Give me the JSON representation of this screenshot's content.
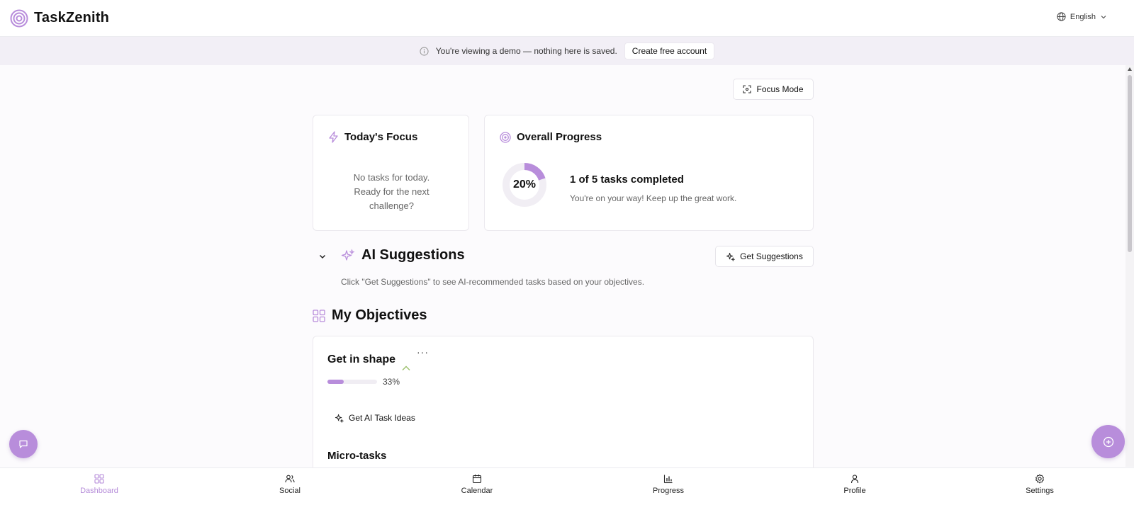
{
  "app": {
    "title": "TaskZenith"
  },
  "header": {
    "language": "English"
  },
  "banner": {
    "text": "You're viewing a demo — nothing here is saved.",
    "cta": "Create free account"
  },
  "toolbar": {
    "focus_mode": "Focus Mode"
  },
  "todays_focus": {
    "title": "Today's Focus",
    "empty_line1": "No tasks for today.",
    "empty_line2": "Ready for the next",
    "empty_line3": "challenge?"
  },
  "overall_progress": {
    "title": "Overall Progress",
    "percent_label": "20%",
    "percent_value": 20,
    "summary": "1 of 5 tasks completed",
    "message": "You're on your way! Keep up the great work."
  },
  "ai_suggestions": {
    "title": "AI Suggestions",
    "button": "Get Suggestions",
    "hint": "Click \"Get Suggestions\" to see AI-recommended tasks based on your objectives."
  },
  "objectives": {
    "title": "My Objectives",
    "items": [
      {
        "name": "Get in shape",
        "progress_label": "33%",
        "progress_value": 33,
        "ai_button": "Get AI Task Ideas",
        "subsection": "Micro-tasks"
      }
    ]
  },
  "nav": {
    "items": [
      {
        "label": "Dashboard"
      },
      {
        "label": "Social"
      },
      {
        "label": "Calendar"
      },
      {
        "label": "Progress"
      },
      {
        "label": "Profile"
      },
      {
        "label": "Settings"
      }
    ]
  },
  "colors": {
    "accent": "#b88ddb",
    "accent_text": "#b48ad8",
    "banner_bg": "#f2eff6"
  }
}
